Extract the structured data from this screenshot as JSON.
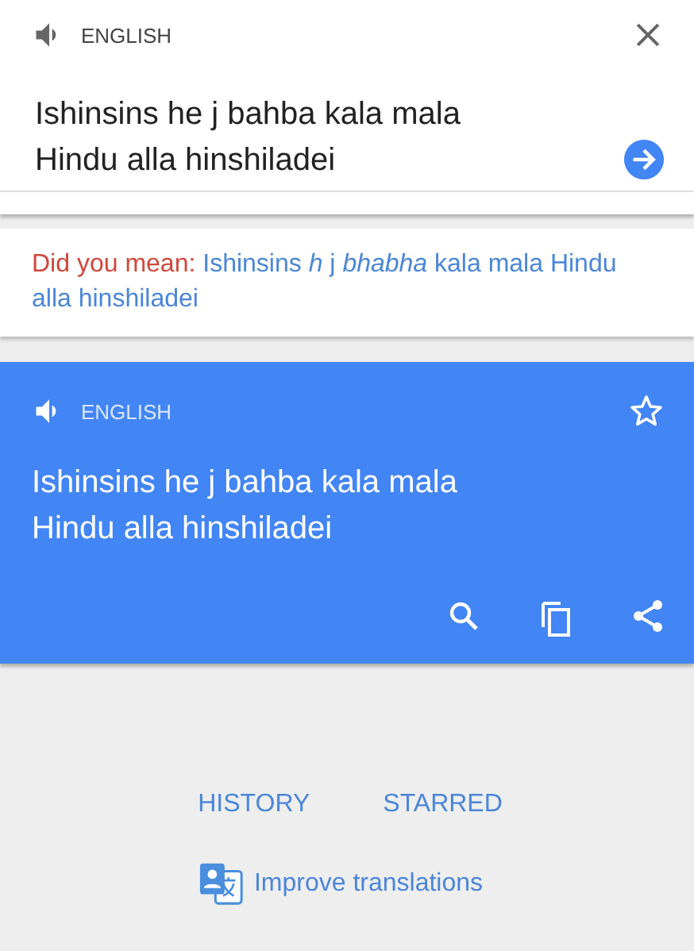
{
  "source": {
    "language": "ENGLISH",
    "text": "Ishinsins he j bahba kala mala\nHindu alla hinshiladei"
  },
  "suggestion": {
    "label": "Did you mean:",
    "text": "Ishinsins *h* j *bhabha* kala mala Hindu alla hinshiladei"
  },
  "result": {
    "language": "ENGLISH",
    "text": "Ishinsins he j bahba kala mala\nHindu alla hinshiladei",
    "starred": false
  },
  "links": [
    "HISTORY",
    "STARRED"
  ],
  "improve": "Improve translations"
}
